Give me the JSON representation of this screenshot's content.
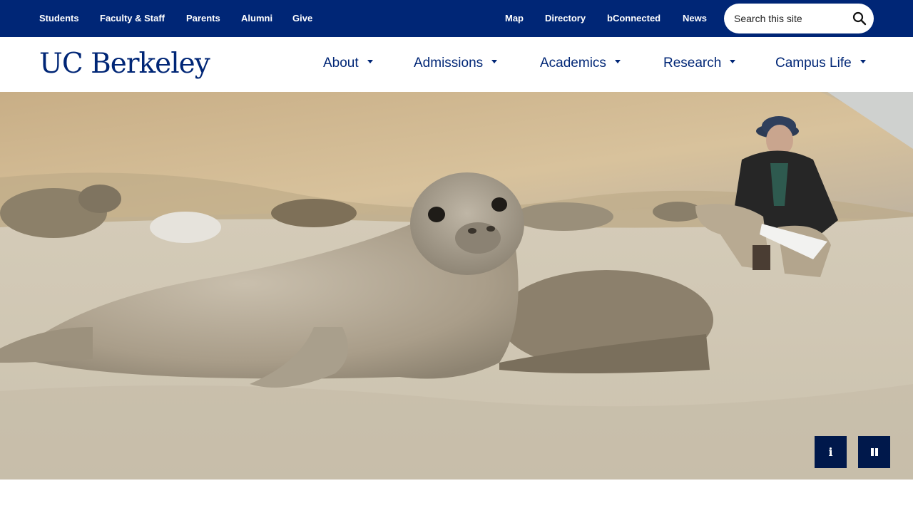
{
  "utility_nav": {
    "left_links": [
      "Students",
      "Faculty & Staff",
      "Parents",
      "Alumni",
      "Give"
    ],
    "right_links": [
      "Map",
      "Directory",
      "bConnected",
      "News"
    ],
    "search": {
      "placeholder": "Search this site",
      "value": ""
    }
  },
  "header": {
    "logo_text": "UC Berkeley",
    "nav": [
      "About",
      "Admissions",
      "Academics",
      "Research",
      "Campus Life"
    ]
  },
  "hero": {
    "image_icon": "elephant-seals-on-beach-photo",
    "info_icon": "info-icon",
    "info_glyph": "i",
    "pause_icon": "pause-icon"
  },
  "colors": {
    "brand_navy": "#002676",
    "control_navy": "#00184b",
    "sand": "#cfc3ae"
  }
}
